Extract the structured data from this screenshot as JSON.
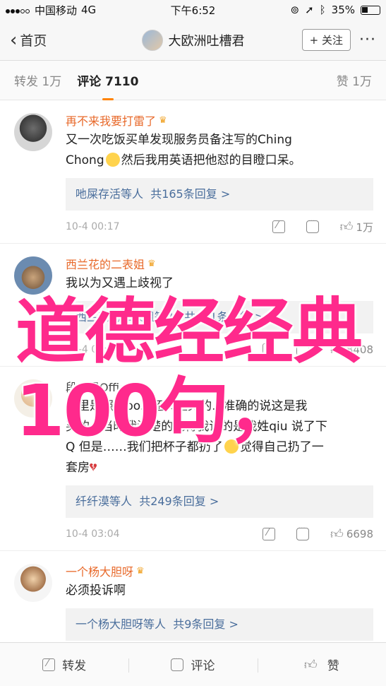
{
  "status_bar": {
    "carrier": "中国移动",
    "network": "4G",
    "time": "下午6:52",
    "battery": "35%"
  },
  "nav": {
    "back_label": "首页",
    "title": "大欧洲吐槽君",
    "follow_label": "+ 关注",
    "more": "···"
  },
  "tabs": [
    {
      "label": "转发 1万"
    },
    {
      "label": "评论 7110"
    },
    {
      "label": "赞 1万"
    }
  ],
  "comments": [
    {
      "name": "再不来我要打雷了",
      "text_1": "又一次吃饭买单发现服务员备注写的Ching",
      "text_2": "Chong",
      "text_3": "然后我用英语把他怼的目瞪口呆。",
      "reply_user": "吔屎存活等人",
      "reply_count": "共165条回复 >",
      "time": "10-4 00:17",
      "likes": "1万"
    },
    {
      "name": "西兰花的二表姐",
      "text_1": "我以为又遇上歧视了",
      "reply_user": "西兰花的二表姐等人",
      "reply_count": "共131条回复 >",
      "time": "10-4 00:17",
      "likes": "8408"
    },
    {
      "name": "段宜恩Official",
      "text_1": "这里是照顾po...还实里克的...准确的说这是我",
      "text_2": "买的...当时我清楚的记得我说的是我姓qiu 说了下",
      "text_3": "Q 但是……我们把杯子都扔了",
      "text_4": "觉得自己扔了一",
      "text_5": "套房",
      "reply_user": "纤纤漠等人",
      "reply_count": "共249条回复 >",
      "time": "10-4 03:04",
      "likes": "6698"
    },
    {
      "name": "一个杨大胆呀",
      "text_1": "必须投诉啊",
      "reply_user": "一个杨大胆呀等人",
      "reply_count": "共9条回复 >"
    }
  ],
  "overlay": {
    "line1": "道德经经典",
    "line2": "100句，"
  },
  "bottom_bar": {
    "repost": "转发",
    "comment": "评论",
    "like": "赞"
  }
}
